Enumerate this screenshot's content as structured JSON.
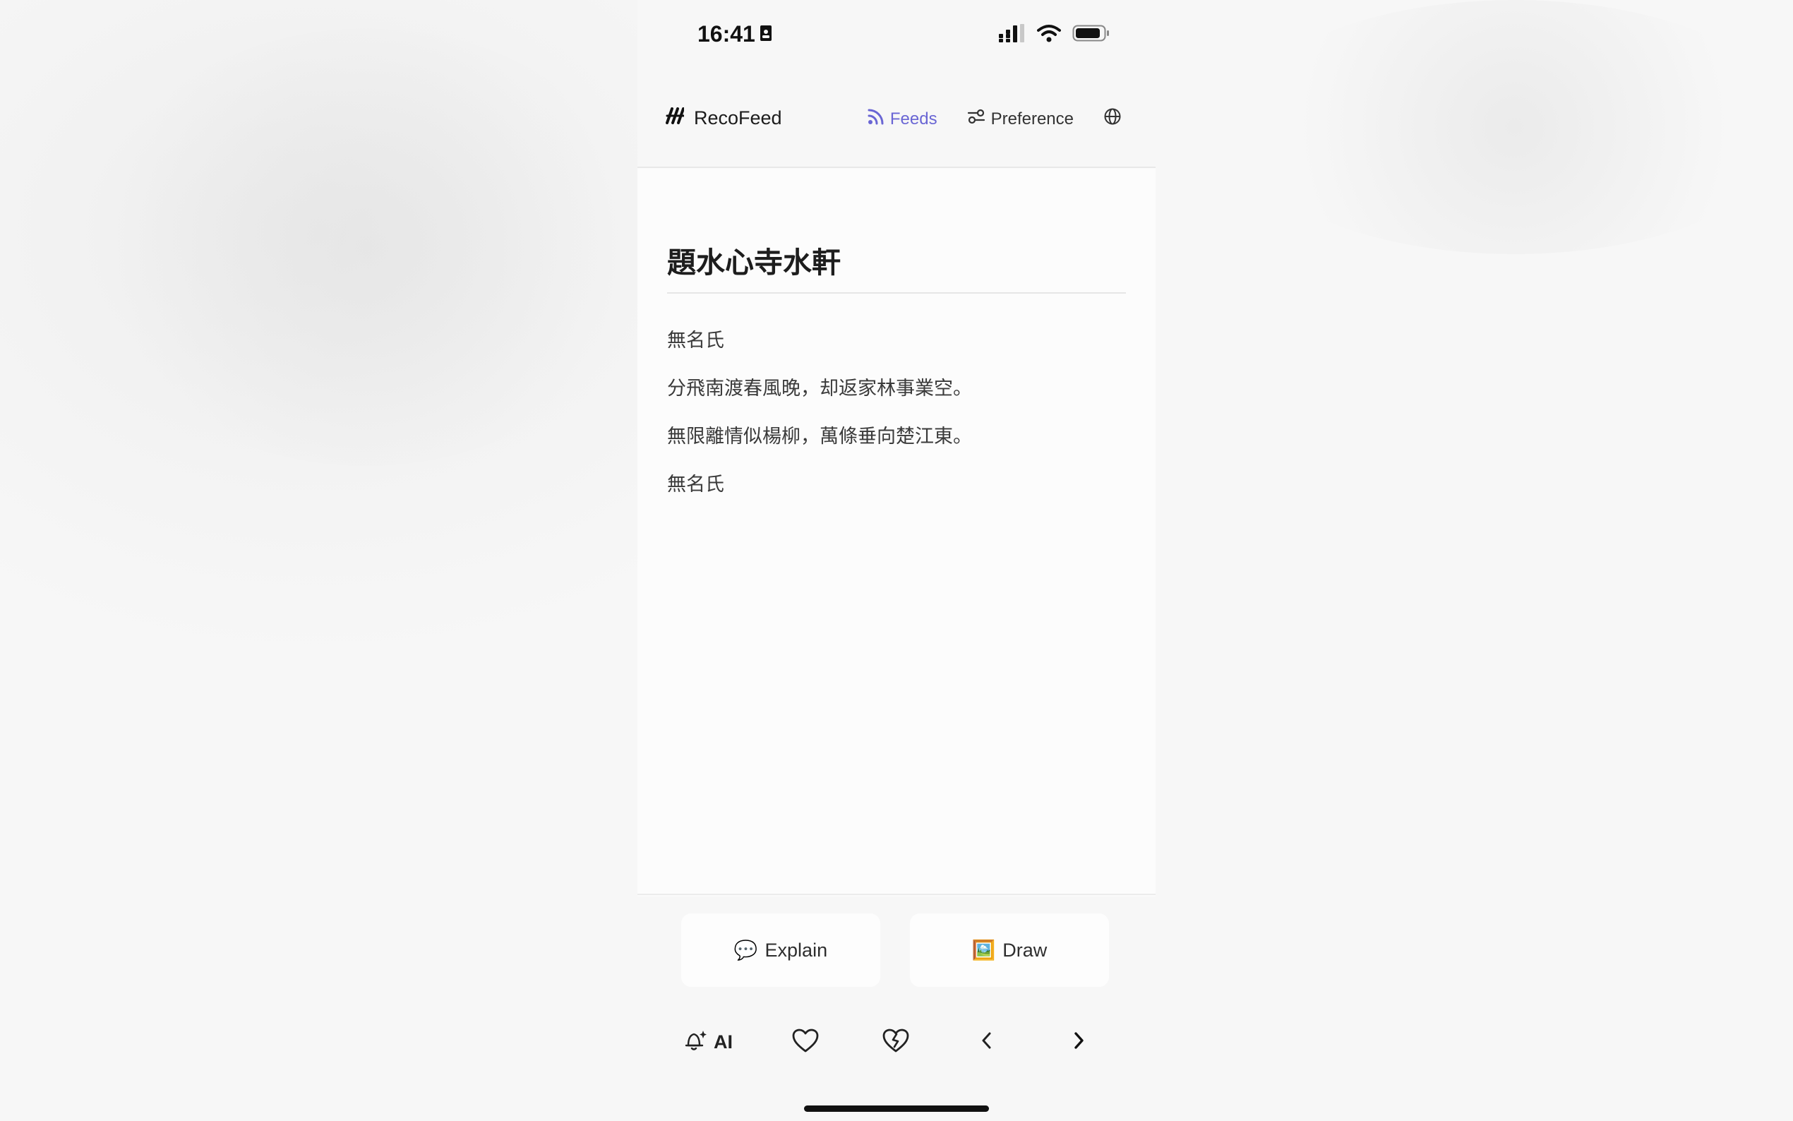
{
  "status_bar": {
    "time": "16:41"
  },
  "header": {
    "brand": "RecoFeed",
    "nav": {
      "feeds": "Feeds",
      "preference": "Preference"
    }
  },
  "poem": {
    "title": "題水心寺水軒",
    "lines": [
      "無名氏",
      "分飛南渡春風晚，却返家林事業空。",
      "無限離情似楊柳，萬條垂向楚江東。",
      "無名氏"
    ]
  },
  "actions": {
    "explain": "Explain",
    "draw": "Draw",
    "explain_emoji": "💬",
    "draw_emoji": "🖼️"
  },
  "toolbar": {
    "ai_label": "AI"
  },
  "colors": {
    "accent": "#6a66d4",
    "text": "#1d1d1d"
  }
}
